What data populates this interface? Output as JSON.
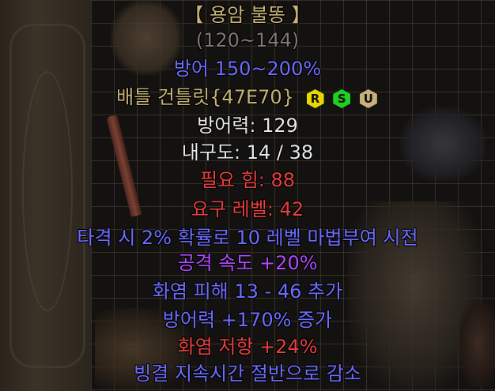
{
  "item": {
    "name": "【 용암 불똥 】",
    "damage_range": "(120~144)",
    "defense_bonus": "방어 150~200%",
    "base_type": "배틀 건틀릿{47E70}",
    "defense": "방어력: 129",
    "durability": "내구도: 14 / 38",
    "req_strength": "필요 힘: 88",
    "req_level": "요구 레벨: 42",
    "mods": {
      "proc": "타격 시 2% 확률로 10 레벨 마법부여 시전",
      "attack_speed": "공격 속도 +20%",
      "fire_damage": "화염 피해 13 - 46 추가",
      "defense_pct": "방어력 +170% 증가",
      "fire_resist": "화염 저항 +24%",
      "freeze_duration": "빙결 지속시간 절반으로 감소"
    }
  },
  "tags": {
    "r": {
      "label": "R",
      "color": "#e8d800"
    },
    "s": {
      "label": "S",
      "color": "#20d020"
    },
    "u": {
      "label": "U",
      "color": "#c8b07a"
    }
  }
}
